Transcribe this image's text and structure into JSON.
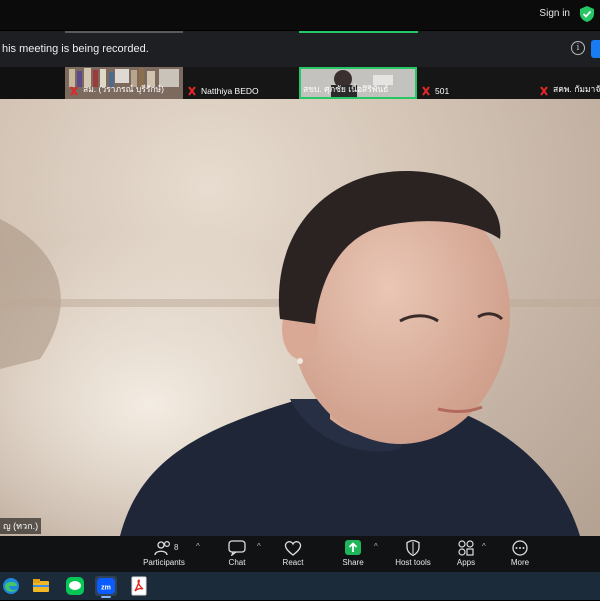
{
  "header": {
    "sign_in_label": "Sign in"
  },
  "recording": {
    "message": "his meeting is being recorded."
  },
  "gallery": [
    {
      "name": "สม. (วราภรณ์ บุรีรักษ์)",
      "muted": true
    },
    {
      "name": "Natthiya BEDO",
      "muted": true
    },
    {
      "name": "สขบ. ศุภชัย เนื่อสิริพันธ์",
      "muted": false
    },
    {
      "name": "501",
      "muted": true
    },
    {
      "name": "สคพ. กัมมาจักร",
      "muted": true
    }
  ],
  "gallery_top_cut": [
    "...",
    "Natthiya BEDO",
    "...",
    "501",
    "..."
  ],
  "speaker": {
    "name": "ญ (ทวก.)"
  },
  "toolbar": {
    "participants_label": "Participants",
    "participants_count": "8",
    "chat_label": "Chat",
    "react_label": "React",
    "share_label": "Share",
    "host_tools_label": "Host tools",
    "apps_label": "Apps",
    "more_label": "More"
  },
  "colors": {
    "accent_green": "#24c764",
    "share_green": "#1fb55b",
    "toolbar_bg": "#111214",
    "taskbar_bg": "#1c2b3a",
    "mute_red": "#e02828"
  },
  "taskbar": [
    "edge-icon",
    "file-explorer-icon",
    "line-icon",
    "zoom-icon",
    "acrobat-icon"
  ]
}
